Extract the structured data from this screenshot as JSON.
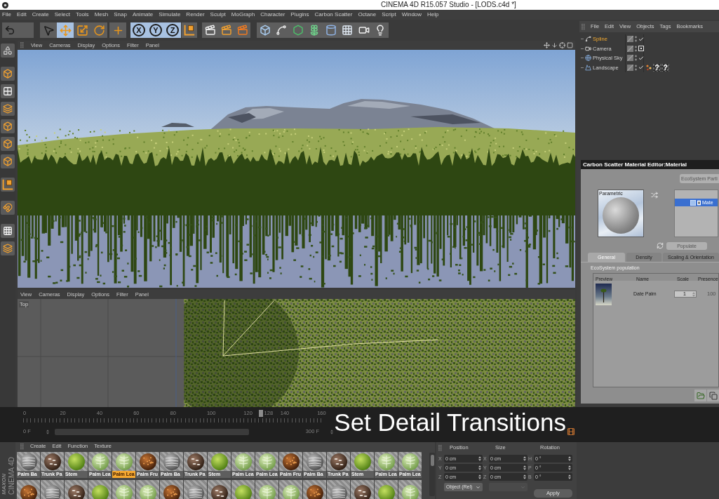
{
  "window": {
    "title": "CINEMA 4D R15.057 Studio - [LODS.c4d *]"
  },
  "menu_bar": [
    "File",
    "Edit",
    "Create",
    "Select",
    "Tools",
    "Mesh",
    "Snap",
    "Animate",
    "Simulate",
    "Render",
    "Sculpt",
    "MoGraph",
    "Character",
    "Plugins",
    "Carbon Scatter",
    "Octane",
    "Script",
    "Window",
    "Help"
  ],
  "toolbar": {
    "tools": [
      {
        "kind": "select",
        "selected": false
      },
      {
        "kind": "move",
        "selected": true
      },
      {
        "kind": "scale",
        "selected": false
      },
      {
        "kind": "rotate",
        "selected": false
      },
      {
        "kind": "add",
        "selected": false
      }
    ],
    "axes": [
      {
        "label": "X",
        "on": true
      },
      {
        "label": "Y",
        "on": true
      },
      {
        "label": "Z",
        "on": true
      }
    ]
  },
  "object_manager": {
    "menu": [
      "File",
      "Edit",
      "View",
      "Objects",
      "Tags",
      "Bookmarks"
    ],
    "objects": [
      {
        "name": "Spline",
        "kind": "spline",
        "selected": true,
        "status": {
          "kind": "check"
        }
      },
      {
        "name": "Camera",
        "kind": "camera",
        "selected": false,
        "status": {
          "kind": "target"
        }
      },
      {
        "name": "Physical Sky",
        "kind": "sky",
        "selected": false,
        "status": {
          "kind": "check"
        }
      },
      {
        "name": "Landscape",
        "kind": "landscape",
        "selected": false,
        "status": {
          "kind": "check"
        },
        "tags": [
          {
            "kind": "scatter"
          },
          {
            "kind": "missing",
            "glyph": "?"
          },
          {
            "kind": "missing",
            "glyph": "?"
          }
        ]
      }
    ]
  },
  "side_toolbar": [
    [
      {
        "kind": "blob"
      }
    ],
    [
      {
        "kind": "cube"
      },
      {
        "kind": "checker-cube"
      },
      {
        "kind": "layers"
      },
      {
        "kind": "cube"
      },
      {
        "kind": "cube"
      },
      {
        "kind": "cube"
      }
    ],
    [
      {
        "kind": "axis"
      }
    ],
    [
      {
        "kind": "magnet"
      }
    ],
    [
      {
        "kind": "checker-plane"
      },
      {
        "kind": "layers"
      }
    ]
  ],
  "viewports": [
    {
      "kind": "perspective",
      "menu": [
        "View",
        "Cameras",
        "Display",
        "Options",
        "Filter",
        "Panel"
      ]
    },
    {
      "kind": "top",
      "label": "Top",
      "menu": [
        "View",
        "Cameras",
        "Display",
        "Options",
        "Filter",
        "Panel"
      ]
    }
  ],
  "material_editor": {
    "title": "Carbon Scatter Material Editor:Material",
    "ecosystem_button": {
      "label": "EcoSystem Parti",
      "disabled": true
    },
    "preview_label": "Parametric",
    "materials": [
      {
        "name": "Mate",
        "selected": true
      }
    ],
    "populate_button": {
      "label": "Populate",
      "disabled": true
    },
    "tabs": [
      {
        "label": "General",
        "selected": true
      },
      {
        "label": "Density",
        "selected": false
      },
      {
        "label": "Scaling & Orientation",
        "selected": false
      }
    ],
    "section": "EcoSystem population",
    "table": {
      "columns": [
        "Preview",
        "Name",
        "Scale",
        "Presence"
      ],
      "rows": [
        {
          "name": "Date Palm",
          "scale": "1",
          "presence": {
            "value": "100",
            "disabled": true
          }
        }
      ]
    }
  },
  "timeline": {
    "ticks": [
      "0",
      "20",
      "40",
      "60",
      "80",
      "100",
      "120",
      "140",
      "160"
    ],
    "playhead": {
      "label": "128",
      "level": 0.427
    },
    "range_start": "0 F",
    "range_end": "300 F"
  },
  "caption": "Set Detail Transitions",
  "logo": {
    "brand": "MAXON",
    "product": "CINEMA 4D"
  },
  "material_manager": {
    "menu": [
      "Create",
      "Edit",
      "Function",
      "Texture"
    ],
    "materials": [
      {
        "name": "Palm Ba",
        "kind": "bark",
        "selected": false
      },
      {
        "name": "Trunk Pa",
        "kind": "trunk",
        "selected": false
      },
      {
        "name": "Stem",
        "kind": "stem",
        "selected": false
      },
      {
        "name": "Palm Lea",
        "kind": "leaf",
        "selected": false
      },
      {
        "name": "Palm Lea",
        "kind": "leaf",
        "selected": true
      },
      {
        "name": "Palm Fru",
        "kind": "fruit",
        "selected": false
      },
      {
        "name": "Palm Ba",
        "kind": "bark",
        "selected": false
      },
      {
        "name": "Trunk Pa",
        "kind": "trunk",
        "selected": false
      },
      {
        "name": "Stem",
        "kind": "stem",
        "selected": false
      },
      {
        "name": "Palm Lea",
        "kind": "leaf",
        "selected": false
      },
      {
        "name": "Palm Lea",
        "kind": "leaf",
        "selected": false
      },
      {
        "name": "Palm Fru",
        "kind": "fruit",
        "selected": false
      },
      {
        "name": "Palm Ba",
        "kind": "bark",
        "selected": false
      },
      {
        "name": "Trunk Pa",
        "kind": "trunk",
        "selected": false
      },
      {
        "name": "Stem",
        "kind": "stem",
        "selected": false
      },
      {
        "name": "Palm Lea",
        "kind": "leaf",
        "selected": false
      },
      {
        "name": "Palm Lea",
        "kind": "leaf",
        "selected": false
      }
    ],
    "next_row": [
      {
        "kind": "fruit"
      },
      {
        "kind": "bark"
      },
      {
        "kind": "trunk"
      },
      {
        "kind": "stem"
      },
      {
        "kind": "leaf"
      },
      {
        "kind": "leaf"
      },
      {
        "kind": "fruit"
      },
      {
        "kind": "bark"
      },
      {
        "kind": "trunk"
      },
      {
        "kind": "stem"
      },
      {
        "kind": "leaf"
      },
      {
        "kind": "leaf"
      },
      {
        "kind": "fruit"
      },
      {
        "kind": "bark"
      },
      {
        "kind": "trunk"
      },
      {
        "kind": "stem"
      },
      {
        "kind": "leaf"
      }
    ]
  },
  "coordinates": {
    "columns": [
      "Position",
      "Size",
      "Rotation"
    ],
    "rows": [
      [
        {
          "axis": "X",
          "value": "0 cm"
        },
        {
          "axis": "X",
          "value": "0 cm"
        },
        {
          "axis": "H",
          "value": "0 °"
        }
      ],
      [
        {
          "axis": "Y",
          "value": "0 cm"
        },
        {
          "axis": "Y",
          "value": "0 cm"
        },
        {
          "axis": "P",
          "value": "0 °"
        }
      ],
      [
        {
          "axis": "Z",
          "value": "0 cm"
        },
        {
          "axis": "Z",
          "value": "0 cm"
        },
        {
          "axis": "B",
          "value": "0 °"
        }
      ]
    ],
    "mode": "Object (Rel)",
    "size_mode": {
      "disabled": true
    },
    "apply": "Apply"
  }
}
